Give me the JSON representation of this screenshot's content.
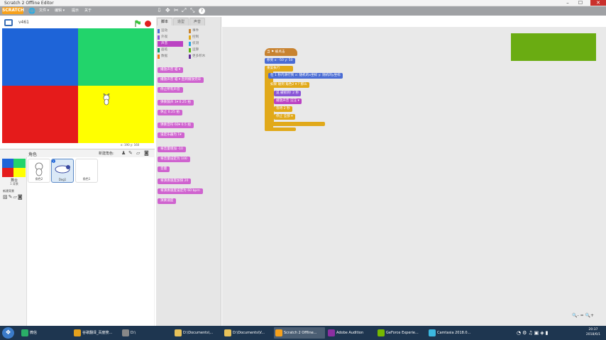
{
  "window": {
    "title": "Scratch 2 Offline Editor",
    "min": "–",
    "max": "☐",
    "close": "✕"
  },
  "menubar": {
    "logo": "SCRATCH",
    "items": [
      "文件 ▾",
      "编辑 ▾",
      "提示",
      "关于"
    ],
    "tools": [
      "⇩",
      "✥",
      "✂",
      "⤢",
      "⤡",
      "?"
    ]
  },
  "stage": {
    "version": "v461",
    "coords": "x: 190  y: 160",
    "quadrants": [
      "#1e64d8",
      "#22d46b",
      "#e51b1b",
      "#ffff00"
    ],
    "flag_color": "#2eb82e",
    "stop_color": "#e02020"
  },
  "sprites": {
    "header": "角色",
    "new_label": "新建角色:",
    "stage_label": "舞台",
    "stage_sub": "1 背景",
    "new_backdrop": "新建背景",
    "items": [
      {
        "name": "角色2"
      },
      {
        "name": "Dog1"
      },
      {
        "name": "角色1"
      }
    ]
  },
  "tabs": [
    "脚本",
    "造型",
    "声音"
  ],
  "categories": [
    {
      "label": "运动",
      "color": "#4a6cd4"
    },
    {
      "label": "事件",
      "color": "#c88330"
    },
    {
      "label": "外观",
      "color": "#8a55d7"
    },
    {
      "label": "控制",
      "color": "#e1a91a"
    },
    {
      "label": "声音",
      "color": "#bb42c3",
      "selected": true
    },
    {
      "label": "侦测",
      "color": "#2ca5e2"
    },
    {
      "label": "画笔",
      "color": "#0e9a6c"
    },
    {
      "label": "运算",
      "color": "#5cb712"
    },
    {
      "label": "数据",
      "color": "#ee7d16"
    },
    {
      "label": "更多积木",
      "color": "#632d99"
    }
  ],
  "palette": [
    "播放声音 喵 ▾",
    "播放声音 喵 ▾ 直到播放完毕",
    "停止所有声音",
    "弹奏鼓声 1▾ 0.25 拍",
    "休止 0.25 拍",
    "弹奏音符 60▾ 0.5 拍",
    "设定乐器为 1▾",
    "将音量增加 -10",
    "将音量设定为 100",
    "音量",
    "将演奏速度加快 20",
    "将演奏速度设定为 60 bpm",
    "演奏速度"
  ],
  "script": {
    "hat": "当 ⚑ 被点击",
    "goto": "移到 x: -50 y: 50",
    "forever": "重复执行",
    "glide": "在 1 秒内滑行到 x: 随机的x坐标 y: 随机的y坐标",
    "if": "如果 碰到 角色2 ▾ ? 那么",
    "say": "说 被抓到! 2 秒",
    "sound": "播放声音 汪汪 ▾",
    "wait": "等待 2 秒",
    "stop": "停止 全部 ▾"
  },
  "zoom": [
    "🔍-",
    "=",
    "🔍+"
  ],
  "taskbar": {
    "start": "❖",
    "items": [
      "微信",
      "谷歌翻译_百度搜...",
      "D:\\",
      "D:\\Documents\\...",
      "D:\\Documents\\V...",
      "Scratch 2 Offline...",
      "Adobe Audition",
      "GeForce Experie...",
      "Camtasia 2018.0..."
    ],
    "time": "20:37",
    "date": "2018/6/1"
  }
}
